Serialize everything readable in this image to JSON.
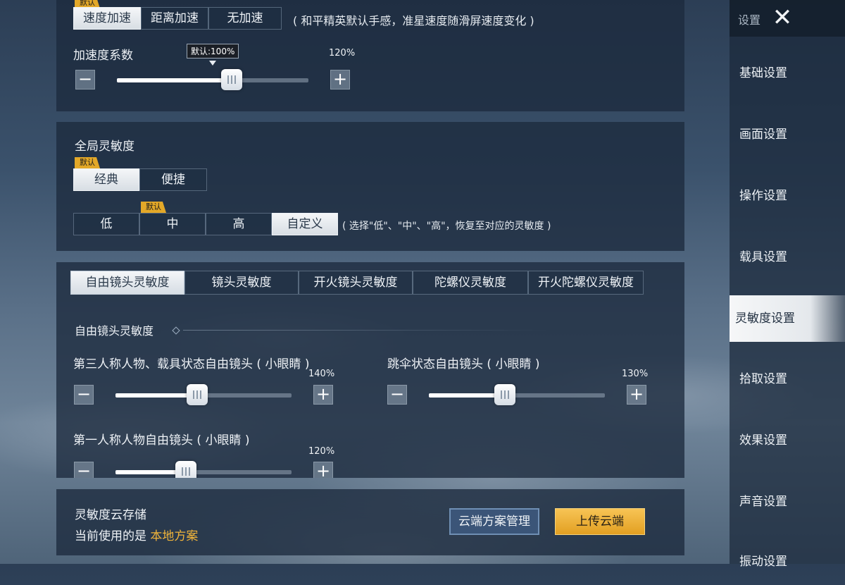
{
  "sidebar": {
    "title": "设置",
    "items": [
      {
        "label": "基础设置"
      },
      {
        "label": "画面设置"
      },
      {
        "label": "操作设置"
      },
      {
        "label": "载具设置"
      },
      {
        "label": "灵敏度设置"
      },
      {
        "label": "拾取设置"
      },
      {
        "label": "效果设置"
      },
      {
        "label": "声音设置"
      },
      {
        "label": "振动设置"
      }
    ],
    "active": "灵敏度设置"
  },
  "accel": {
    "default_tag": "默认",
    "options": [
      "速度加速",
      "距离加速",
      "无加速"
    ],
    "selected": "速度加速",
    "hint": "( 和平精英默认手感，准星速度随滑屏速度变化 )",
    "coef_label": "加速度系数",
    "tooltip": "默认:100%",
    "value": "120%",
    "slider_fraction": 0.6
  },
  "global": {
    "title": "全局灵敏度",
    "mode_tag": "默认",
    "modes": [
      "经典",
      "便捷"
    ],
    "selected_mode": "经典",
    "level_tag": "默认",
    "levels": [
      "低",
      "中",
      "高",
      "自定义"
    ],
    "selected_level": "自定义",
    "hint": "( 选择\"低\"、\"中\"、\"高\"，恢复至对应的灵敏度 )"
  },
  "tabs": [
    "自由镜头灵敏度",
    "镜头灵敏度",
    "开火镜头灵敏度",
    "陀螺仪灵敏度",
    "开火陀螺仪灵敏度"
  ],
  "selected_tab": "自由镜头灵敏度",
  "free_cam": {
    "section_title": "自由镜头灵敏度",
    "sliders": [
      {
        "label": "第三人称人物、载具状态自由镜头 ( 小眼睛 )",
        "value": "140%",
        "fraction": 0.46
      },
      {
        "label": "跳伞状态自由镜头 ( 小眼睛 )",
        "value": "130%",
        "fraction": 0.43
      },
      {
        "label": "第一人称人物自由镜头 ( 小眼睛 )",
        "value": "120%",
        "fraction": 0.4
      }
    ]
  },
  "cloud": {
    "title": "灵敏度云存储",
    "current_prefix": "当前使用的是",
    "current_plan": "本地方案",
    "manage_button": "云端方案管理",
    "upload_button": "上传云端"
  },
  "colors": {
    "accent_gold": "#e3a828",
    "plan_text": "#f0b43a"
  },
  "icons": {
    "close": "close-icon",
    "minus": "minus-icon",
    "plus": "plus-icon"
  }
}
